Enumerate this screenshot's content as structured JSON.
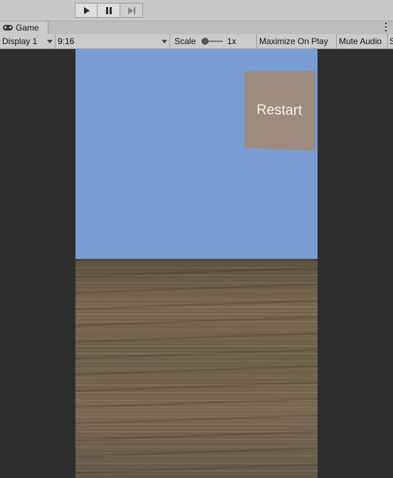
{
  "playbar": {
    "buttons": [
      "play-icon",
      "pause-icon",
      "step-icon"
    ]
  },
  "tab": {
    "label": "Game",
    "icon": "gamepad-icon"
  },
  "toolbar": {
    "display": "Display 1",
    "aspect": "9:16",
    "scale_label": "Scale",
    "scale_value": "1x",
    "maximize": "Maximize On Play",
    "mute": "Mute Audio",
    "overflow": "S"
  },
  "game": {
    "sky_color": "#7a9dd4",
    "floor_color": "#6b5d46",
    "restart_label": "Restart",
    "restart_color": "#9c8b7e"
  }
}
